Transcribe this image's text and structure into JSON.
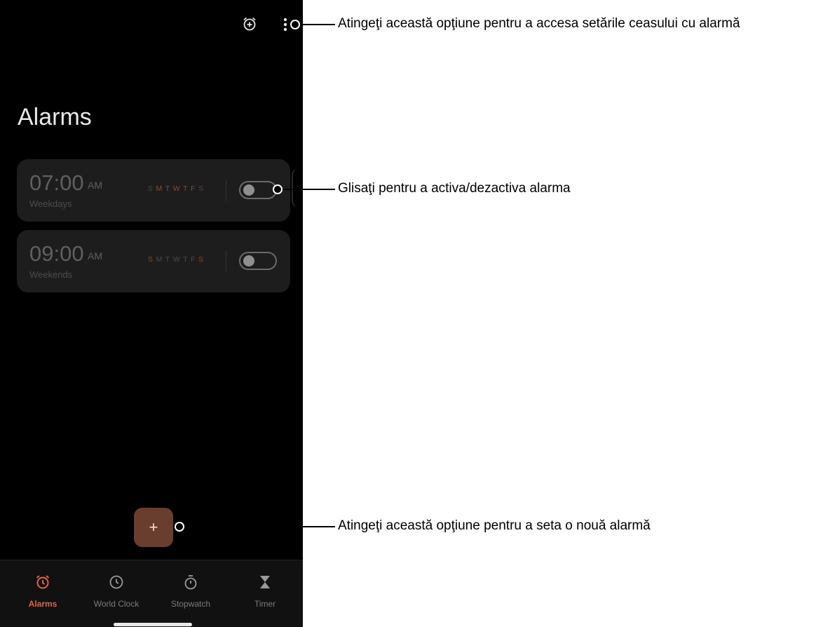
{
  "app": {
    "title": "Alarms"
  },
  "alarms": [
    {
      "time": "07:00",
      "ampm": "AM",
      "repeat": "Weekdays",
      "days": [
        {
          "letter": "S",
          "active": false
        },
        {
          "letter": "M",
          "active": true
        },
        {
          "letter": "T",
          "active": true
        },
        {
          "letter": "W",
          "active": true
        },
        {
          "letter": "T",
          "active": true
        },
        {
          "letter": "F",
          "active": true
        },
        {
          "letter": "S",
          "active": false
        }
      ],
      "enabled": false
    },
    {
      "time": "09:00",
      "ampm": "AM",
      "repeat": "Weekends",
      "days": [
        {
          "letter": "S",
          "active": true
        },
        {
          "letter": "M",
          "active": false
        },
        {
          "letter": "T",
          "active": false
        },
        {
          "letter": "W",
          "active": false
        },
        {
          "letter": "T",
          "active": false
        },
        {
          "letter": "F",
          "active": false
        },
        {
          "letter": "S",
          "active": true
        }
      ],
      "enabled": false
    }
  ],
  "fab": {
    "label": "+"
  },
  "nav": [
    {
      "label": "Alarms",
      "icon": "alarm-clock-icon",
      "active": true
    },
    {
      "label": "World Clock",
      "icon": "clock-icon",
      "active": false
    },
    {
      "label": "Stopwatch",
      "icon": "stopwatch-icon",
      "active": false
    },
    {
      "label": "Timer",
      "icon": "hourglass-icon",
      "active": false
    }
  ],
  "callouts": {
    "settings": "Atingeţi această opţiune pentru a accesa setările ceasului cu alarmă",
    "toggle": "Glisaţi pentru a activa/dezactiva alarma",
    "add": "Atingeţi această opţiune pentru a seta o nouă alarmă"
  },
  "colors": {
    "accent": "#e2643a",
    "fab": "#6a3e2e",
    "card": "#1d1d1d",
    "background": "#000000"
  }
}
